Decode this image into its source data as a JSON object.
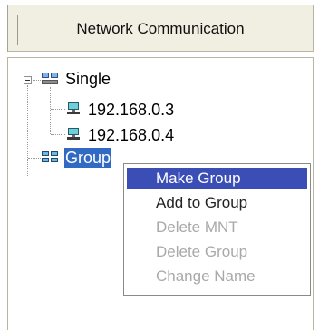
{
  "header": {
    "title": "Network Communication"
  },
  "tree": {
    "single": {
      "label": "Single",
      "children": [
        {
          "label": "192.168.0.3"
        },
        {
          "label": "192.168.0.4"
        }
      ]
    },
    "group": {
      "label": "Group"
    }
  },
  "context_menu": {
    "items": [
      {
        "label": "Make Group",
        "state": "highlighted"
      },
      {
        "label": "Add to Group",
        "state": "enabled"
      },
      {
        "label": "Delete MNT",
        "state": "disabled"
      },
      {
        "label": "Delete Group",
        "state": "disabled"
      },
      {
        "label": "Change Name",
        "state": "disabled"
      }
    ]
  }
}
